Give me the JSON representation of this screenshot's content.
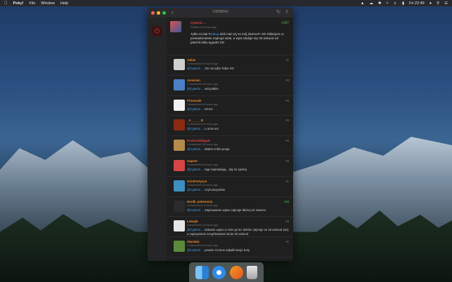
{
  "menubar": {
    "app_name": "Poky!",
    "items": [
      "File",
      "Window",
      "Help"
    ],
    "clock": "Fri 22:49"
  },
  "window": {
    "title": "#3898843"
  },
  "post": {
    "author": "Cyberlo ...",
    "meta": "Posted 16 hours ago",
    "votes": "+167",
    "body_pre": "Tylko mi tak #",
    "body_tag": "zakup",
    "body_post": " dziś mał czy to mój internet? XD Kliknięcie w powiadomienie zajmuje wiek, a wpis dodaje się 30 sekund od jakichś kilku tygodni XD"
  },
  "comments": [
    {
      "author": "Julian",
      "meta": "Commented 16 hours ago",
      "mention": "@Cyberlo ...",
      "text": " XD nie tylko Tobie XD",
      "votes": "+1",
      "author_color": "orange",
      "vote_color": "green",
      "avatar_color": "#cfcfcf"
    },
    {
      "author": "Jeremian",
      "meta": "Commented 16 hours ago",
      "mention": "@Cyberlo ...",
      "text": " wszystkim",
      "votes": "+0",
      "author_color": "orange",
      "vote_color": "gray",
      "avatar_color": "#4c7fc4"
    },
    {
      "author": "Prinosaek",
      "meta": "Commented 16 hours ago",
      "mention": "@Cyberlo ...",
      "text": " Mi też.",
      "votes": "+0",
      "author_color": "orange",
      "vote_color": "gray",
      "avatar_color": "#f2f2f2"
    },
    {
      "author": "_A______B",
      "meta": "Commented 16 hours ago",
      "mention": "@Cyberlo ...",
      "text": " u mnie też",
      "votes": "+0",
      "author_color": "orange",
      "vote_color": "gray",
      "avatar_color": "#8b2a12"
    },
    {
      "author": "Rocksolidhippie",
      "meta": "Commented 16 hours ago",
      "mention": "@Cyberlo ...",
      "text": " Białek zróbe pouje.",
      "votes": "+0",
      "author_color": "red",
      "vote_color": "gray",
      "avatar_color": "#b58a4a"
    },
    {
      "author": "wapent",
      "meta": "Commented 16 hours ago",
      "mention": "@Cyberlo ...",
      "text": " tagi nieprawiają... daj im spokój",
      "votes": "+0",
      "author_color": "orange",
      "vote_color": "gray",
      "avatar_color": "#d64545"
    },
    {
      "author": "GrimFortyvon",
      "meta": "Commented 16 hours ago",
      "mention": "@Cyberlo ...",
      "text": " czyli wszystkim",
      "votes": "+1",
      "author_color": "orange",
      "vote_color": "green",
      "avatar_color": "#3e8fbf"
    },
    {
      "author": "Hordk_pokemony",
      "meta": "Commented 16 hours ago",
      "mention": "@Cyberlo ...",
      "text": " Zapisuwanie wpisu zajmuje dłużej niż zawsze",
      "votes": "+89",
      "author_color": "orange",
      "vote_color": "green",
      "avatar_color": "#2b2b2b"
    },
    {
      "author": "Lewayk",
      "meta": "Commented 16 hours ago",
      "mention": "@Cyberlo ...",
      "text": " dodanie wpisu u mnie przez telefon zajmuje ze 40 sekund (xD) a zapisywanie szegółowiwek okolo 20 sekund",
      "votes": "+0",
      "author_color": "orange",
      "vote_color": "green",
      "avatar_color": "#e6e6e6"
    },
    {
      "author": "skarabej",
      "meta": "Commented 16 hours ago",
      "mention": "@Cyberlo ...",
      "text": " pewnie Cronos odpalił swoje boty",
      "votes": "+1",
      "author_color": "orange",
      "vote_color": "gray",
      "avatar_color": "#5b8a3a"
    },
    {
      "author": "BalanceProject",
      "meta": "Commented 16 hours ago",
      "mention": "@Cyberlo ...",
      "text": "",
      "votes": "+1",
      "author_color": "orange",
      "vote_color": "gray",
      "avatar_color": "#d9c34a"
    }
  ],
  "dock": {
    "apps": [
      "finder-icon",
      "safari-icon",
      "cheese-icon",
      "trash-icon"
    ]
  }
}
